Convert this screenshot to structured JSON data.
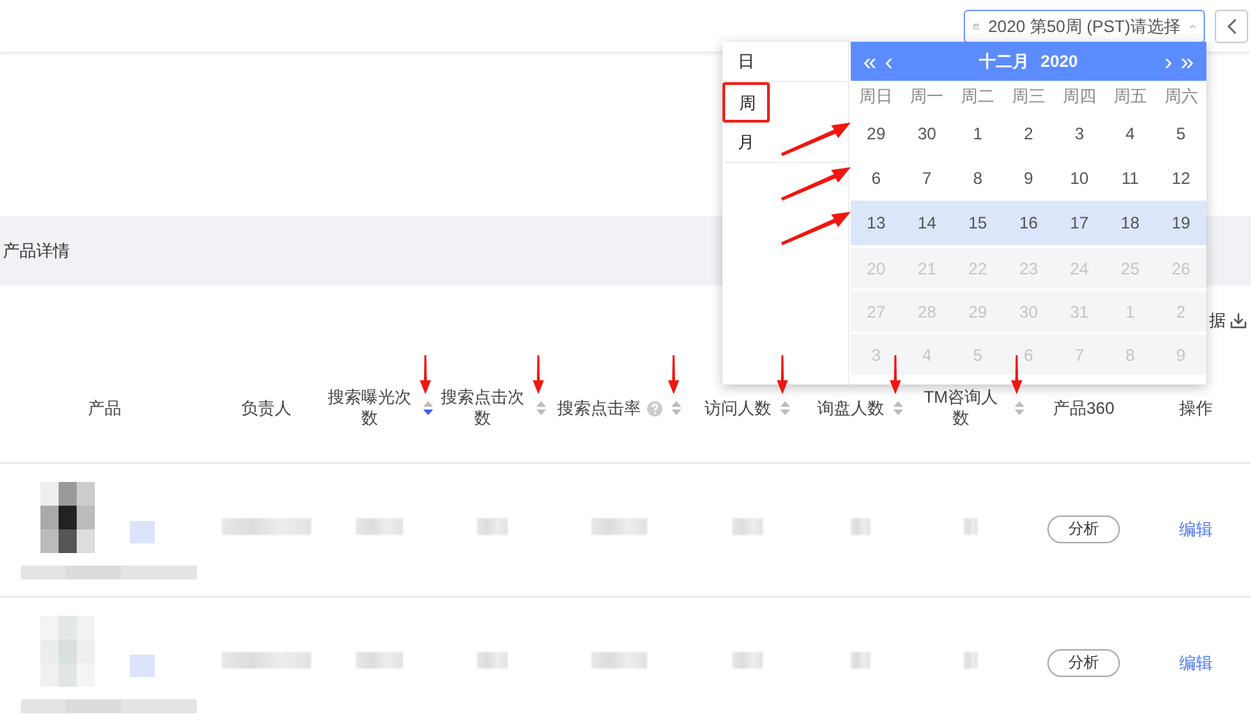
{
  "date_picker": {
    "value": "2020 第50周 (PST)请选择",
    "open": true
  },
  "section_title": "产品详情",
  "download_label": "据",
  "period_menu": [
    {
      "label": "日",
      "highlighted": false
    },
    {
      "label": "周",
      "highlighted": true
    },
    {
      "label": "月",
      "highlighted": false
    }
  ],
  "calendar": {
    "nav_prev_year": "«",
    "nav_prev_month": "‹",
    "month": "十二月",
    "year": "2020",
    "nav_next_month": "›",
    "nav_next_year": "»",
    "weekdays": [
      "周日",
      "周一",
      "周二",
      "周三",
      "周四",
      "周五",
      "周六"
    ],
    "weeks": [
      {
        "days": [
          "29",
          "30",
          "1",
          "2",
          "3",
          "4",
          "5"
        ],
        "selected": false,
        "disabled": false,
        "marked": true
      },
      {
        "days": [
          "6",
          "7",
          "8",
          "9",
          "10",
          "11",
          "12"
        ],
        "selected": false,
        "disabled": false,
        "marked": true
      },
      {
        "days": [
          "13",
          "14",
          "15",
          "16",
          "17",
          "18",
          "19"
        ],
        "selected": true,
        "disabled": false,
        "marked": true
      },
      {
        "days": [
          "20",
          "21",
          "22",
          "23",
          "24",
          "25",
          "26"
        ],
        "selected": false,
        "disabled": true,
        "marked": false
      },
      {
        "days": [
          "27",
          "28",
          "29",
          "30",
          "31",
          "1",
          "2"
        ],
        "selected": false,
        "disabled": true,
        "marked": false
      },
      {
        "days": [
          "3",
          "4",
          "5",
          "6",
          "7",
          "8",
          "9"
        ],
        "selected": false,
        "disabled": true,
        "marked": false
      }
    ]
  },
  "columns": [
    {
      "label": "产品",
      "sortable": false,
      "help": false,
      "marked": false
    },
    {
      "label": "负责人",
      "sortable": false,
      "help": false,
      "marked": false
    },
    {
      "label": "搜索曝光次数",
      "sortable": true,
      "sorted_desc": true,
      "help": false,
      "marked": true
    },
    {
      "label": "搜索点击次数",
      "sortable": true,
      "sorted_desc": false,
      "help": false,
      "marked": true
    },
    {
      "label": "搜索点击率",
      "sortable": true,
      "sorted_desc": false,
      "help": true,
      "marked": true
    },
    {
      "label": "访问人数",
      "sortable": true,
      "sorted_desc": false,
      "help": false,
      "marked": true
    },
    {
      "label": "询盘人数",
      "sortable": true,
      "sorted_desc": false,
      "help": false,
      "marked": true
    },
    {
      "label": "TM咨询人数",
      "sortable": true,
      "sorted_desc": false,
      "help": false,
      "marked": true
    },
    {
      "label": "产品360",
      "sortable": false,
      "help": false,
      "marked": false
    },
    {
      "label": "操作",
      "sortable": false,
      "help": false,
      "marked": false
    }
  ],
  "rows": [
    {
      "kind": "redacted",
      "button": "分析",
      "link": "编辑"
    },
    {
      "kind": "redacted",
      "button": "分析",
      "link": "编辑"
    }
  ]
}
